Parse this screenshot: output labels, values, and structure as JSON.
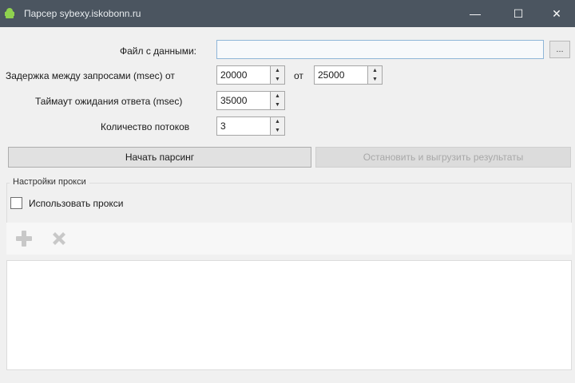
{
  "window": {
    "title": "Парсер sybexy.iskobonn.ru",
    "icon": "android-icon",
    "controls": {
      "minimize": "—",
      "maximize": "☐",
      "close": "✕"
    }
  },
  "form": {
    "file_label": "Файл с данными:",
    "file_value": "",
    "browse_label": "...",
    "delay_label": "Задержка между запросами (msec) от",
    "delay_from": "20000",
    "delay_to_label": "от",
    "delay_to": "25000",
    "timeout_label": "Таймаут ожидания ответа (msec)",
    "timeout_value": "35000",
    "threads_label": "Количество потоков",
    "threads_value": "3"
  },
  "actions": {
    "start_label": "Начать парсинг",
    "stop_label": "Остановить и выгрузить результаты",
    "stop_enabled": false
  },
  "proxy": {
    "group_title": "Настройки прокси",
    "use_proxy_label": "Использовать прокси",
    "use_proxy_checked": false,
    "toolbar": [
      {
        "icon": "plus-icon",
        "enabled": false
      },
      {
        "icon": "delete-icon",
        "enabled": false
      }
    ],
    "items": []
  },
  "colors": {
    "titlebar": "#4b5560",
    "window_bg": "#f0f0f0",
    "disabled_icon": "#c8c8c8"
  }
}
